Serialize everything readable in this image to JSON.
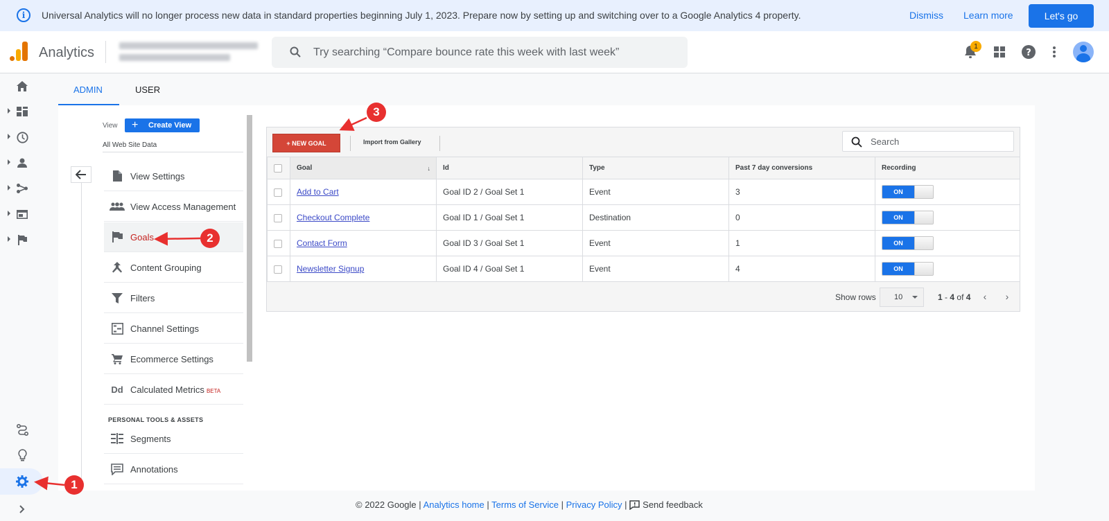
{
  "banner": {
    "message": "Universal Analytics will no longer process new data in standard properties beginning July 1, 2023. Prepare now by setting up and switching over to a Google Analytics 4 property.",
    "dismiss_label": "Dismiss",
    "learn_more_label": "Learn more",
    "lets_go_label": "Let's go"
  },
  "header": {
    "app_title": "Analytics",
    "search_placeholder": "Try searching “Compare bounce rate this week with last week”",
    "notification_count": "1"
  },
  "admin_tabs": [
    {
      "label": "ADMIN",
      "active": true
    },
    {
      "label": "USER",
      "active": false
    }
  ],
  "view_panel": {
    "view_label": "View",
    "create_view_label": "Create View",
    "view_name": "All Web Site Data",
    "menu": [
      {
        "label": "View Settings",
        "icon": "document-icon"
      },
      {
        "label": "View Access Management",
        "icon": "people-icon"
      },
      {
        "label": "Goals",
        "icon": "flag-icon",
        "active": true
      },
      {
        "label": "Content Grouping",
        "icon": "content-grouping-icon"
      },
      {
        "label": "Filters",
        "icon": "filter-icon"
      },
      {
        "label": "Channel Settings",
        "icon": "channel-icon"
      },
      {
        "label": "Ecommerce Settings",
        "icon": "cart-icon"
      },
      {
        "label": "Calculated Metrics",
        "icon": "dd-icon",
        "badge": "BETA"
      }
    ],
    "section_title": "PERSONAL TOOLS & ASSETS",
    "tools": [
      {
        "label": "Segments",
        "icon": "segments-icon"
      },
      {
        "label": "Annotations",
        "icon": "annotations-icon"
      }
    ]
  },
  "goals": {
    "new_goal_label": "+ NEW GOAL",
    "import_label": "Import from Gallery",
    "search_placeholder": "Search",
    "columns": [
      "Goal",
      "Id",
      "Type",
      "Past 7 day conversions",
      "Recording"
    ],
    "rows": [
      {
        "goal": "Add to Cart",
        "id": "Goal ID 2 / Goal Set 1",
        "type": "Event",
        "conversions": "3",
        "recording": "ON"
      },
      {
        "goal": "Checkout Complete",
        "id": "Goal ID 1 / Goal Set 1",
        "type": "Destination",
        "conversions": "0",
        "recording": "ON"
      },
      {
        "goal": "Contact Form",
        "id": "Goal ID 3 / Goal Set 1",
        "type": "Event",
        "conversions": "1",
        "recording": "ON"
      },
      {
        "goal": "Newsletter Signup",
        "id": "Goal ID 4 / Goal Set 1",
        "type": "Event",
        "conversions": "4",
        "recording": "ON"
      }
    ],
    "show_rows_label": "Show rows",
    "rows_per_page": "10",
    "range_start": "1",
    "range_end": "4",
    "range_of": "of",
    "range_total": "4"
  },
  "footer": {
    "copyright": "© 2022 Google",
    "analytics_home": "Analytics home",
    "terms": "Terms of Service",
    "privacy": "Privacy Policy",
    "feedback": "Send feedback",
    "sep": "|"
  },
  "callouts": [
    "1",
    "2",
    "3"
  ],
  "colors": {
    "accent": "#1a73e8",
    "new_goal": "#d44638",
    "callout": "#e8302f"
  }
}
